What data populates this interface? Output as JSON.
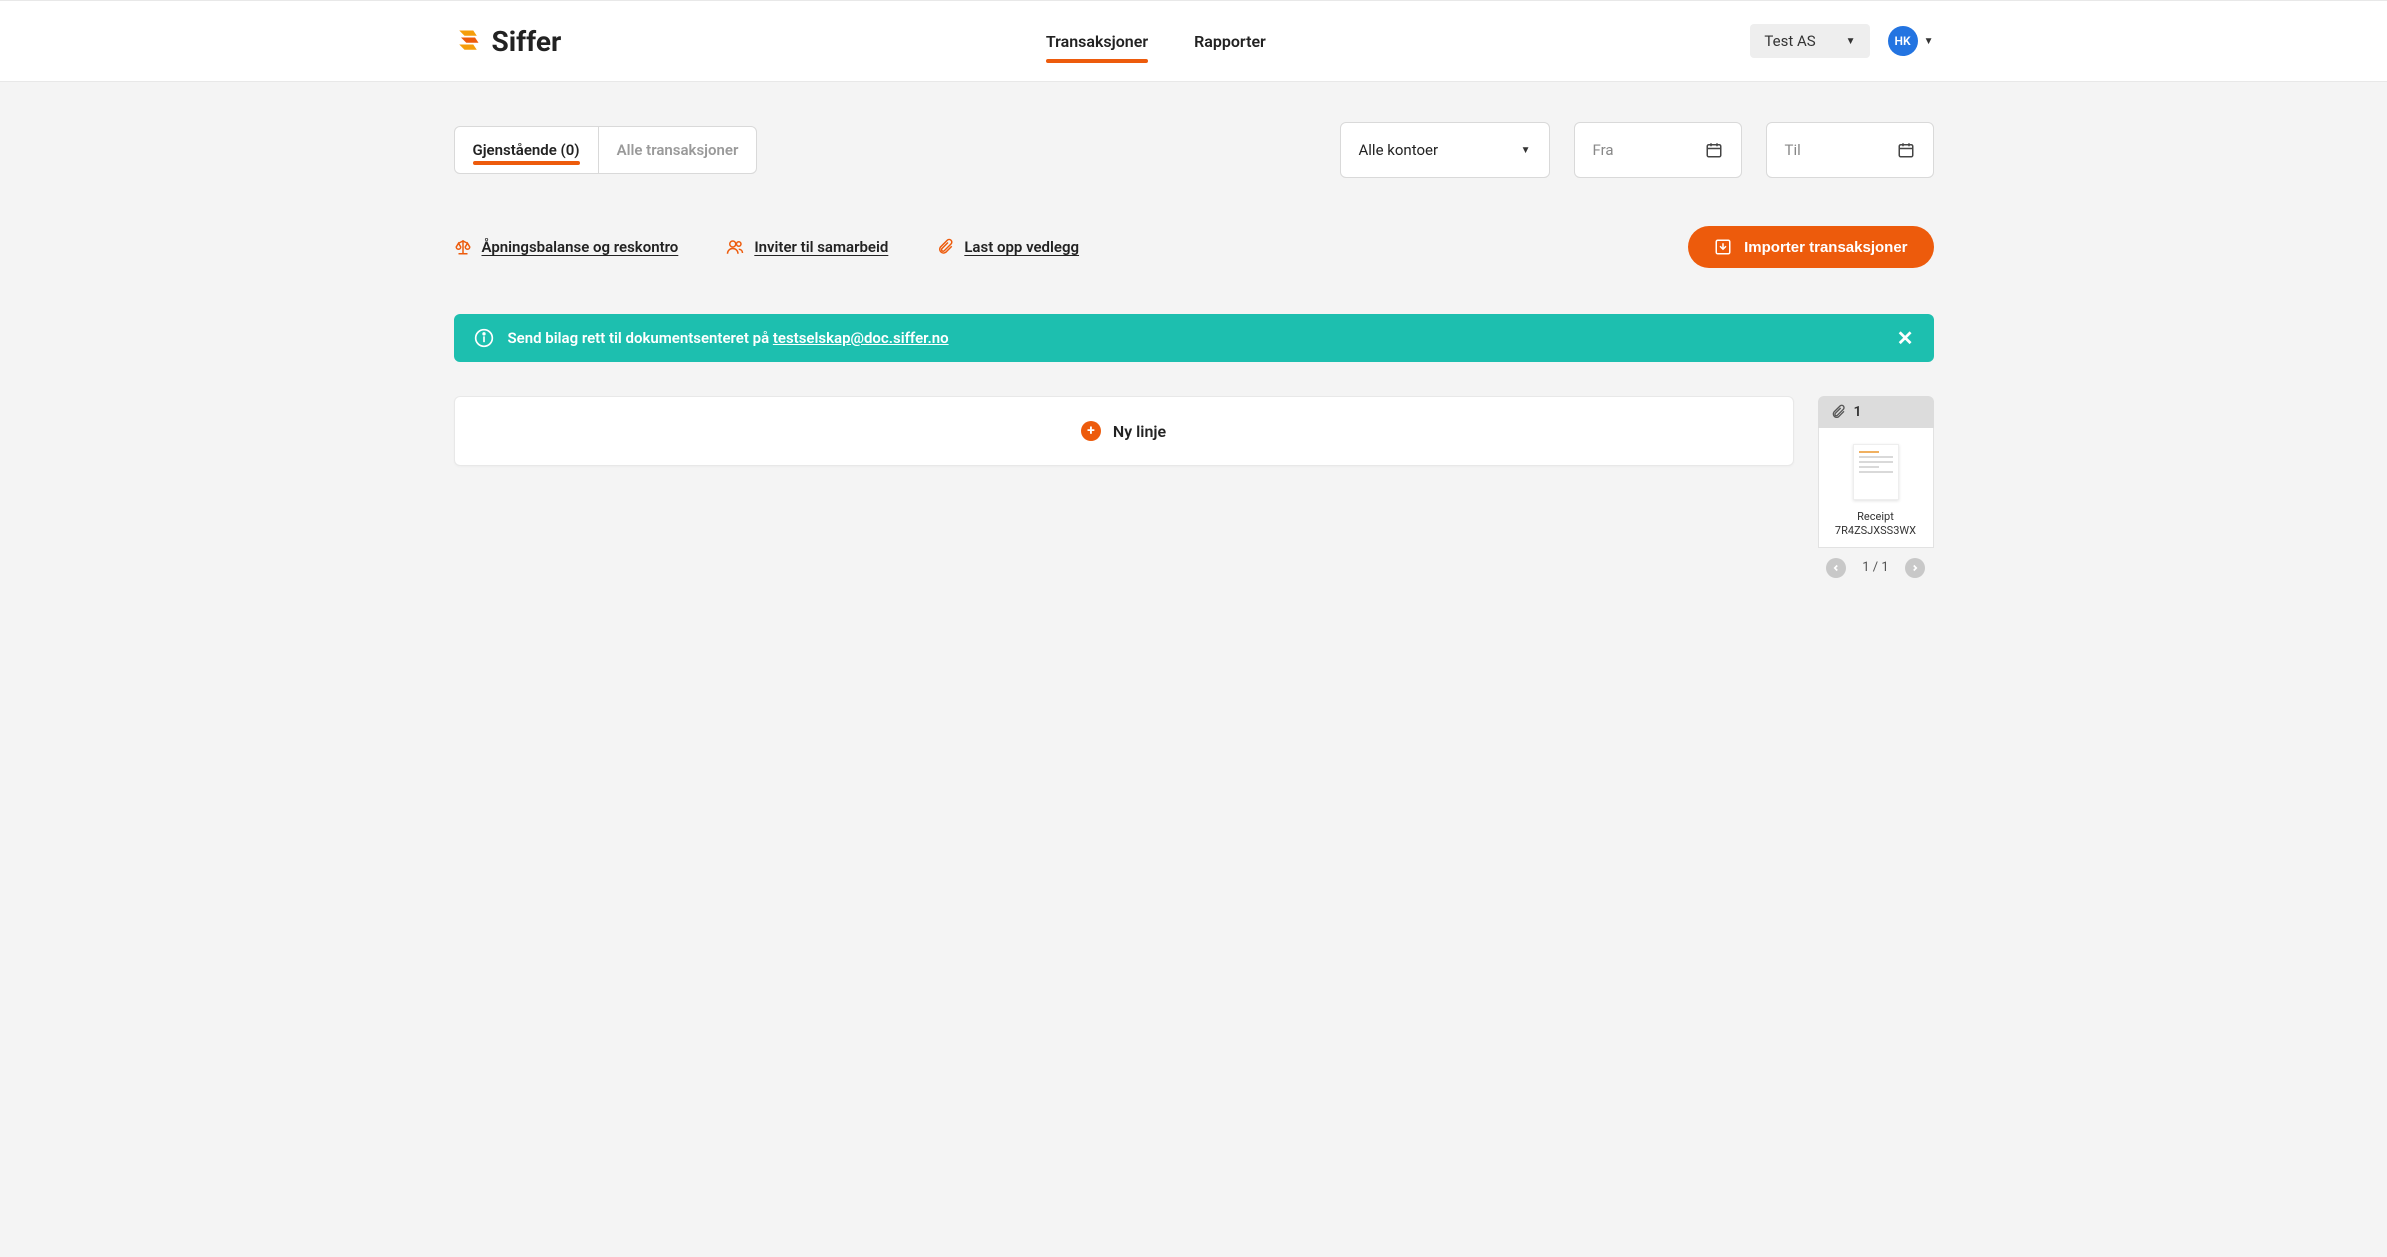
{
  "brand": {
    "name": "Siffer"
  },
  "nav": {
    "transactions": "Transaksjoner",
    "reports": "Rapporter"
  },
  "header": {
    "company": "Test AS",
    "avatar_initials": "HK"
  },
  "tabs": {
    "pending": "Gjenstående (0)",
    "all": "Alle transaksjoner"
  },
  "filters": {
    "accounts": "Alle kontoer",
    "from_placeholder": "Fra",
    "to_placeholder": "Til"
  },
  "action_links": {
    "opening_balance": "Åpningsbalanse og reskontro",
    "invite": "Inviter til samarbeid",
    "upload": "Last opp vedlegg"
  },
  "primary_button": "Importer transaksjoner",
  "banner": {
    "text_prefix": "Send bilag rett til dokumentsenteret på ",
    "email": "testselskap@doc.siffer.no"
  },
  "new_line": "Ny linje",
  "attachments": {
    "count": "1",
    "doc_name_line1": "Receipt",
    "doc_name_line2": "7R4ZSJXSS3WX",
    "pager": "1 / 1"
  }
}
